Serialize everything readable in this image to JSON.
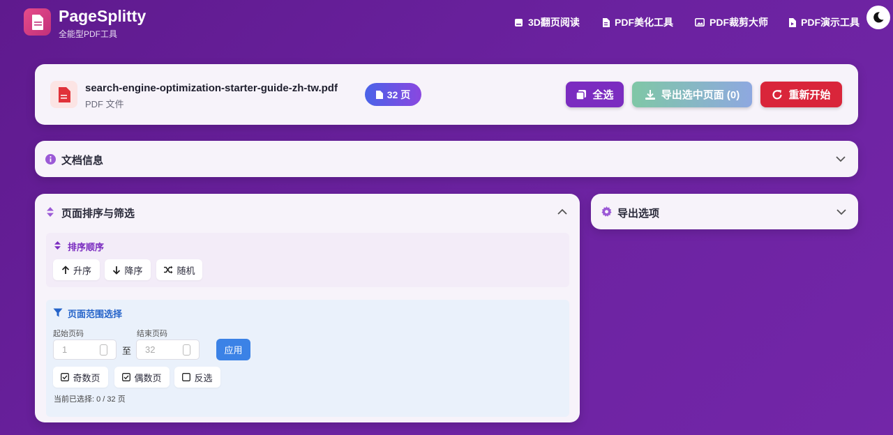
{
  "header": {
    "brand": "PageSplitty",
    "tagline": "全能型PDF工具",
    "nav": [
      {
        "label": "3D翻页阅读",
        "icon": "book-icon"
      },
      {
        "label": "PDF美化工具",
        "icon": "document-icon"
      },
      {
        "label": "PDF裁剪大师",
        "icon": "image-icon"
      },
      {
        "label": "PDF演示工具",
        "icon": "slides-icon"
      }
    ],
    "theme_icon": "moon-icon"
  },
  "file": {
    "name": "search-engine-optimization-starter-guide-zh-tw.pdf",
    "type": "PDF 文件",
    "pages_badge": "32 页"
  },
  "actions": {
    "select_all": "全选",
    "export_selected": "导出选中页面 (0)",
    "restart": "重新开始"
  },
  "doc_info": {
    "title": "文档信息"
  },
  "sort_filter": {
    "title": "页面排序与筛选",
    "order": {
      "title": "排序顺序",
      "asc": "升序",
      "desc": "降序",
      "random": "随机"
    },
    "range": {
      "title": "页面范围选择",
      "start_label": "起始页码",
      "end_label": "结束页码",
      "start_placeholder": "1",
      "end_placeholder": "32",
      "to": "至",
      "apply": "应用",
      "odd": "奇数页",
      "even": "偶数页",
      "invert": "反选",
      "odd_checked": true,
      "even_checked": true,
      "invert_checked": false,
      "status": "当前已选择: 0 / 32 页"
    }
  },
  "export_options": {
    "title": "导出选项"
  },
  "colors": {
    "accent": "#7b2cc0",
    "danger": "#d9253a",
    "primary_blue": "#3b82e6"
  }
}
